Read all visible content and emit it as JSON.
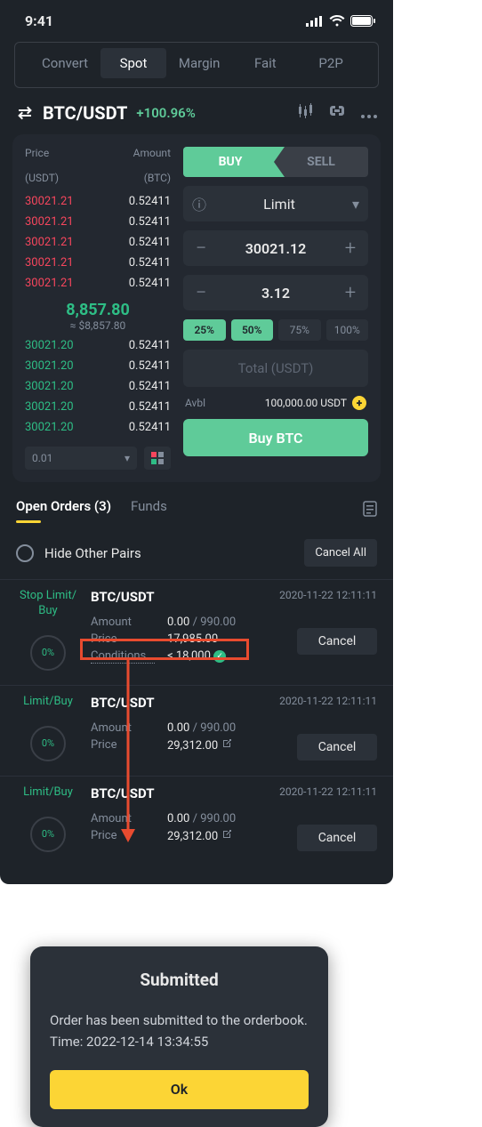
{
  "status": {
    "time": "9:41"
  },
  "tabs": [
    "Convert",
    "Spot",
    "Margin",
    "Fait",
    "P2P"
  ],
  "active_tab": 1,
  "pair": {
    "symbol": "BTC/USDT",
    "change": "+100.96%"
  },
  "orderbook": {
    "price_label": "Price",
    "price_unit": "(USDT)",
    "amount_label": "Amount",
    "amount_unit": "(BTC)",
    "asks": [
      {
        "p": "30021.21",
        "a": "0.52411"
      },
      {
        "p": "30021.21",
        "a": "0.52411"
      },
      {
        "p": "30021.21",
        "a": "0.52411"
      },
      {
        "p": "30021.21",
        "a": "0.52411"
      },
      {
        "p": "30021.21",
        "a": "0.52411"
      }
    ],
    "mid": {
      "price": "8,857.80",
      "approx": "≈ $8,857.80"
    },
    "bids": [
      {
        "p": "30021.20",
        "a": "0.52411"
      },
      {
        "p": "30021.20",
        "a": "0.52411"
      },
      {
        "p": "30021.20",
        "a": "0.52411"
      },
      {
        "p": "30021.20",
        "a": "0.52411"
      },
      {
        "p": "30021.20",
        "a": "0.52411"
      }
    ],
    "step": "0.01"
  },
  "form": {
    "buy_label": "BUY",
    "sell_label": "SELL",
    "order_type": "Limit",
    "price": "30021.12",
    "amount": "3.12",
    "pcts": [
      "25%",
      "50%",
      "75%",
      "100%"
    ],
    "total_label": "Total (USDT)",
    "avbl_label": "Avbl",
    "avbl_value": "100,000.00 USDT",
    "submit_label": "Buy BTC"
  },
  "orders": {
    "open_tab": "Open Orders (3)",
    "funds_tab": "Funds",
    "hide_label": "Hide Other Pairs",
    "cancel_all": "Cancel All",
    "items": [
      {
        "type": "Stop Limit/\nBuy",
        "pair": "BTC/USDT",
        "time": "2020-11-22  12:11:11",
        "amount_lbl": "Amount",
        "amount": "0.00",
        "amount_total": "990.00",
        "price_lbl": "Price",
        "price": "17,985.00",
        "cond_lbl": "Conditions",
        "cond": "≤ 18,000",
        "pct": "0%",
        "cancel": "Cancel"
      },
      {
        "type": "Limit/Buy",
        "pair": "BTC/USDT",
        "time": "2020-11-22  12:11:11",
        "amount_lbl": "Amount",
        "amount": "0.00",
        "amount_total": "990.00",
        "price_lbl": "Price",
        "price": "29,312.00",
        "pct": "0%",
        "cancel": "Cancel"
      },
      {
        "type": "Limit/Buy",
        "pair": "BTC/USDT",
        "time": "2020-11-22  12:11:11",
        "amount_lbl": "Amount",
        "amount": "0.00",
        "amount_total": "990.00",
        "price_lbl": "Price",
        "price": "29,312.00",
        "pct": "0%",
        "cancel": "Cancel"
      }
    ]
  },
  "modal": {
    "title": "Submitted",
    "line1": "Order has been submitted to the orderbook.",
    "line2": "Time: 2022-12-14 13:34:55",
    "ok": "Ok"
  }
}
